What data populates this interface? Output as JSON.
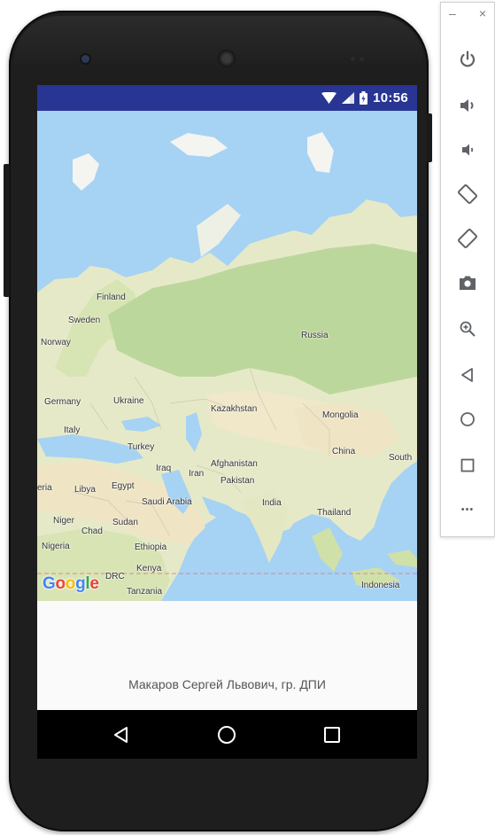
{
  "status_bar": {
    "time": "10:56",
    "icons": [
      "wifi-icon",
      "cell-signal-icon",
      "battery-icon"
    ]
  },
  "map": {
    "labels": {
      "finland": "Finland",
      "sweden": "Sweden",
      "norway": "Norway",
      "russia": "Russia",
      "germany": "Germany",
      "ukraine": "Ukraine",
      "italy": "Italy",
      "kazakhstan": "Kazakhstan",
      "mongolia": "Mongolia",
      "turkey": "Turkey",
      "iraq": "Iraq",
      "iran": "Iran",
      "afghanistan": "Afghanistan",
      "pakistan": "Pakistan",
      "china": "China",
      "south": "South",
      "algeria_partial": "eria",
      "libya": "Libya",
      "egypt": "Egypt",
      "saudi_arabia": "Saudi Arabia",
      "india": "India",
      "thailand": "Thailand",
      "niger": "Niger",
      "chad": "Chad",
      "sudan": "Sudan",
      "nigeria": "Nigeria",
      "ethiopia": "Ethiopia",
      "drc": "DRC",
      "kenya": "Kenya",
      "tanzania": "Tanzania",
      "indonesia": "Indonesia"
    },
    "logo": {
      "letters": [
        "G",
        "o",
        "o",
        "g",
        "l",
        "e"
      ],
      "colors": [
        "#4285F4",
        "#EA4335",
        "#FBBC05",
        "#4285F4",
        "#34A853",
        "#EA4335"
      ]
    }
  },
  "content": {
    "author": "Макаров Сергей Львович, гр. ДПИ"
  },
  "nav_bar": {
    "buttons": [
      "back-icon",
      "home-icon",
      "recents-icon"
    ]
  },
  "toolbar": {
    "window_controls": {
      "minimize": "–",
      "close": "×"
    },
    "tools": [
      "power-icon",
      "volume-up-icon",
      "volume-down-icon",
      "rotate-left-icon",
      "rotate-right-icon",
      "camera-icon",
      "zoom-icon",
      "back-icon",
      "home-icon",
      "overview-icon",
      "more-icon"
    ],
    "more_label": "•••"
  },
  "colors": {
    "status_bar": "#283593",
    "water": "#a6d2f4",
    "land": "#e6e9c8",
    "forest": "#b8d89a",
    "desert": "#efe5c4",
    "toolbar_icon": "#5f6368"
  }
}
